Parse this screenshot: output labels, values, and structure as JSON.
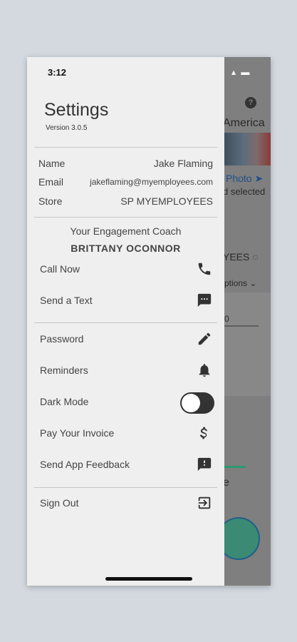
{
  "status_bar": {
    "time": "3:12"
  },
  "settings": {
    "title": "Settings",
    "version": "Version 3.0.5"
  },
  "profile": {
    "name_label": "Name",
    "name_value": "Jake Flaming",
    "email_label": "Email",
    "email_value": "jakeflaming@myemployees.com",
    "store_label": "Store",
    "store_value": "SP MYEMPLOYEES"
  },
  "coach": {
    "title": "Your Engagement Coach",
    "name": "BRITTANY OCONNOR"
  },
  "coach_actions": [
    {
      "label": "Call Now",
      "icon": "phone-icon"
    },
    {
      "label": "Send a Text",
      "icon": "message-icon"
    }
  ],
  "menu": [
    {
      "label": "Password",
      "icon": "pencil-icon"
    },
    {
      "label": "Reminders",
      "icon": "bell-icon"
    },
    {
      "label": "Dark Mode",
      "icon": "toggle-switch",
      "value": false
    },
    {
      "label": "Pay Your Invoice",
      "icon": "dollar-icon"
    },
    {
      "label": "Send App Feedback",
      "icon": "feedback-icon"
    }
  ],
  "sign_out": {
    "label": "Sign Out",
    "icon": "sign-out-icon"
  },
  "background_app": {
    "help": "?",
    "text1": "America",
    "photo_label": "Photo",
    "selected_label": "d selected",
    "yees_label": "YEES",
    "options_label": "ptions",
    "o_label": "0",
    "e_label": "e"
  },
  "colors": {
    "drawer_bg": "#efefef",
    "overlay": "#7f7f7f",
    "accent_green": "#2a9a70",
    "link_blue": "#1f4f8a"
  }
}
